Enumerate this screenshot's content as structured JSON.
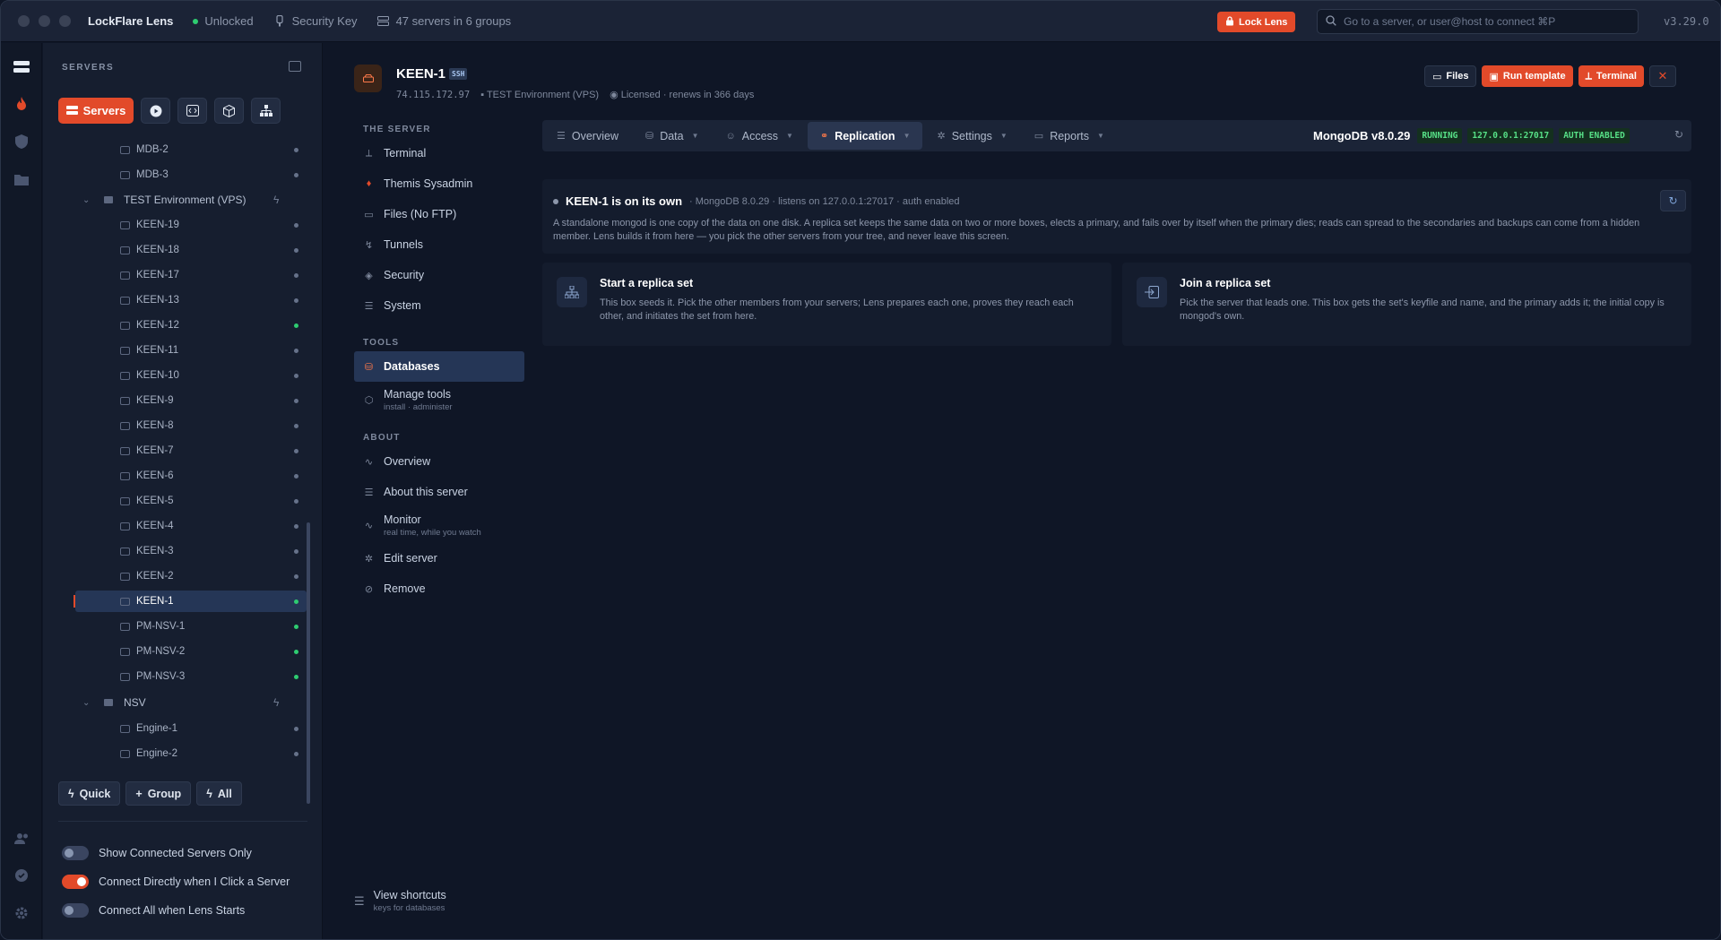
{
  "window": {
    "app_title": "LockFlare Lens",
    "status": "Unlocked",
    "security_key": "Security Key",
    "servers_summary": "47 servers in 6 groups",
    "lock_button": "Lock Lens",
    "search_placeholder": "Go to a server, or user@host to connect  ⌘P",
    "version": "v3.29.0"
  },
  "sidebar": {
    "heading": "SERVERS",
    "active_tab": "Servers",
    "tree": [
      {
        "type": "server",
        "name": "MDB-2",
        "status": "idle"
      },
      {
        "type": "server",
        "name": "MDB-3",
        "status": "idle"
      },
      {
        "type": "group",
        "name": "TEST Environment (VPS)"
      },
      {
        "type": "server",
        "name": "KEEN-19",
        "status": "idle"
      },
      {
        "type": "server",
        "name": "KEEN-18",
        "status": "idle"
      },
      {
        "type": "server",
        "name": "KEEN-17",
        "status": "idle"
      },
      {
        "type": "server",
        "name": "KEEN-13",
        "status": "idle"
      },
      {
        "type": "server",
        "name": "KEEN-12",
        "status": "connected"
      },
      {
        "type": "server",
        "name": "KEEN-11",
        "status": "idle"
      },
      {
        "type": "server",
        "name": "KEEN-10",
        "status": "idle"
      },
      {
        "type": "server",
        "name": "KEEN-9",
        "status": "idle"
      },
      {
        "type": "server",
        "name": "KEEN-8",
        "status": "idle"
      },
      {
        "type": "server",
        "name": "KEEN-7",
        "status": "idle"
      },
      {
        "type": "server",
        "name": "KEEN-6",
        "status": "idle"
      },
      {
        "type": "server",
        "name": "KEEN-5",
        "status": "idle"
      },
      {
        "type": "server",
        "name": "KEEN-4",
        "status": "idle"
      },
      {
        "type": "server",
        "name": "KEEN-3",
        "status": "idle"
      },
      {
        "type": "server",
        "name": "KEEN-2",
        "status": "idle"
      },
      {
        "type": "server",
        "name": "KEEN-1",
        "status": "connected",
        "selected": true
      },
      {
        "type": "server",
        "name": "PM-NSV-1",
        "status": "connected"
      },
      {
        "type": "server",
        "name": "PM-NSV-2",
        "status": "connected"
      },
      {
        "type": "server",
        "name": "PM-NSV-3",
        "status": "connected"
      },
      {
        "type": "group",
        "name": "NSV"
      },
      {
        "type": "server",
        "name": "Engine-1",
        "status": "idle"
      },
      {
        "type": "server",
        "name": "Engine-2",
        "status": "idle"
      }
    ],
    "actions": {
      "quick": "Quick",
      "group": "Group",
      "all": "All"
    },
    "toggles": [
      {
        "label": "Show Connected Servers Only",
        "on": false
      },
      {
        "label": "Connect Directly when I Click a Server",
        "on": true
      },
      {
        "label": "Connect All when Lens Starts",
        "on": false
      }
    ]
  },
  "server": {
    "name": "KEEN-1",
    "protocol": "SSH",
    "ip": "74.115.172.97",
    "group": "TEST Environment (VPS)",
    "license": "Licensed · renews in 366 days",
    "buttons": {
      "files": "Files",
      "run_template": "Run template",
      "terminal": "Terminal"
    }
  },
  "nav": {
    "section_server": "THE SERVER",
    "server_items": [
      "Terminal",
      "Themis Sysadmin",
      "Files (No FTP)",
      "Tunnels",
      "Security",
      "System"
    ],
    "section_tools": "TOOLS",
    "tools_databases": "Databases",
    "tools_manage": "Manage tools",
    "tools_manage_sub": "install · administer",
    "section_about": "ABOUT",
    "about_overview": "Overview",
    "about_this": "About this server",
    "about_monitor": "Monitor",
    "about_monitor_sub": "real time, while you watch",
    "about_edit": "Edit server",
    "about_remove": "Remove",
    "shortcuts": "View shortcuts",
    "shortcuts_sub": "keys for databases"
  },
  "tabs": [
    "Overview",
    "Data",
    "Access",
    "Replication",
    "Settings",
    "Reports"
  ],
  "db_status": {
    "version": "MongoDB v8.0.29",
    "state": "RUNNING",
    "endpoint": "127.0.0.1:27017",
    "auth": "AUTH ENABLED"
  },
  "standalone": {
    "title": "KEEN-1 is on its own",
    "meta": "· MongoDB 8.0.29 · listens on 127.0.0.1:27017 · auth enabled",
    "description": "A standalone mongod is one copy of the data on one disk. A replica set keeps the same data on two or more boxes, elects a primary, and fails over by itself when the primary dies; reads can spread to the secondaries and backups can come from a hidden member. Lens builds it from here — you pick the other servers from your tree, and never leave this screen."
  },
  "cards": {
    "start_title": "Start a replica set",
    "start_desc": "This box seeds it. Pick the other members from your servers; Lens prepares each one, proves they reach each other, and initiates the set from here.",
    "join_title": "Join a replica set",
    "join_desc": "Pick the server that leads one. This box gets the set's keyfile and name, and the primary adds it; the initial copy is mongod's own."
  },
  "colors": {
    "accent": "#e24a2a",
    "connected": "#2ecc71",
    "badge_text": "#57e087"
  }
}
